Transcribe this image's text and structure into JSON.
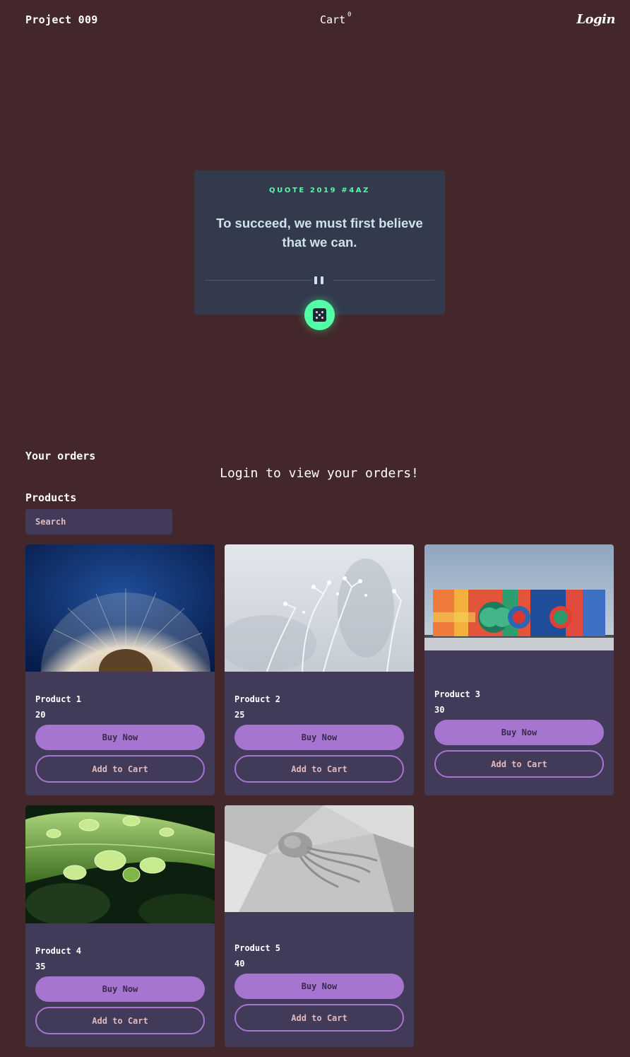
{
  "nav": {
    "brand": "Project 009",
    "cart_label": "Cart",
    "cart_count": "0",
    "login_label": "Login"
  },
  "quote": {
    "tag": "QUOTE 2019 #4AZ",
    "text": "To succeed, we must first believe that we can.",
    "pause_icon": "pause-icon",
    "dice_icon": "dice-icon"
  },
  "orders": {
    "title": "Your orders",
    "message": "Login to view your orders!"
  },
  "products": {
    "title": "Products",
    "search_placeholder": "Search",
    "buy_label": "Buy Now",
    "add_label": "Add to Cart",
    "items": [
      {
        "name": "Product 1",
        "price": "20",
        "image": "dandelion"
      },
      {
        "name": "Product 2",
        "price": "25",
        "image": "frosted-plants"
      },
      {
        "name": "Product 3",
        "price": "30",
        "image": "mural-building"
      },
      {
        "name": "Product 4",
        "price": "35",
        "image": "wet-leaf"
      },
      {
        "name": "Product 5",
        "price": "40",
        "image": "jellyfish-render"
      }
    ]
  },
  "colors": {
    "background": "#43272a",
    "card": "#413a59",
    "quote_card": "#323a4b",
    "accent_green": "#52ffa6",
    "accent_purple": "#a575d0",
    "button_text": "#e2b9bc"
  }
}
